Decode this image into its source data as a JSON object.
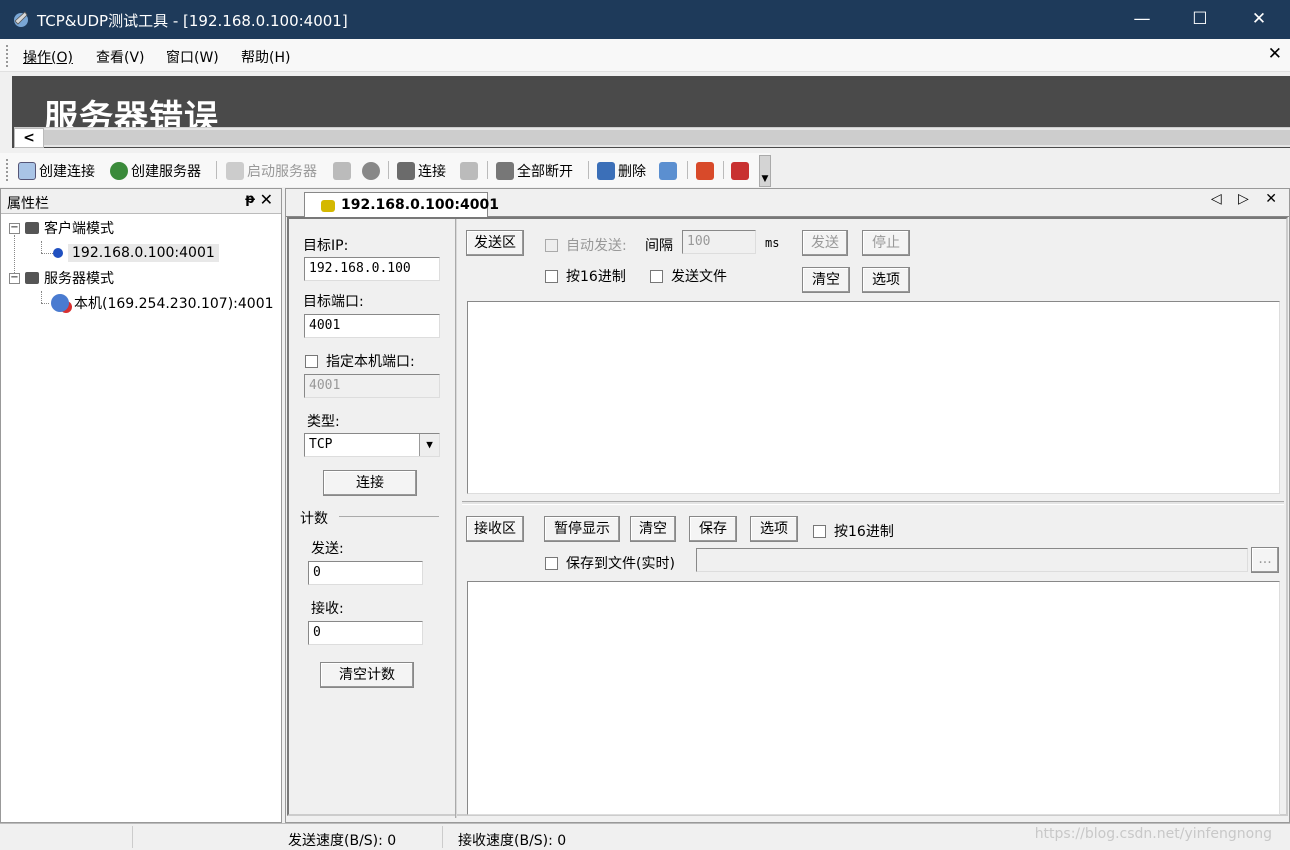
{
  "window": {
    "title": "TCP&UDP测试工具 - [192.168.0.100:4001]",
    "minimize": "—",
    "maximize": "☐",
    "close": "✕"
  },
  "menu": {
    "items": [
      "操作(O)",
      "查看(V)",
      "窗口(W)",
      "帮助(H)"
    ],
    "close": "✕"
  },
  "error_pane": {
    "title": "服务器错误",
    "scroll_left": "<"
  },
  "toolbar": {
    "create_connection": "创建连接",
    "create_server": "创建服务器",
    "start_server": "启动服务器",
    "connect": "连接",
    "disconnect_all": "全部断开",
    "delete": "删除"
  },
  "sidebar": {
    "title": "属性栏",
    "pin": "ᵽ",
    "close": "✕",
    "tree": {
      "client_mode": "客户端模式",
      "client_connection": "192.168.0.100:4001",
      "server_mode": "服务器模式",
      "server_local": "本机(169.254.230.107):4001"
    }
  },
  "tab": {
    "label": "192.168.0.100:4001",
    "nav": "◁ ▷ ✕"
  },
  "connection_form": {
    "target_ip_label": "目标IP:",
    "target_ip_value": "192.168.0.100",
    "target_port_label": "目标端口:",
    "target_port_value": "4001",
    "local_port_checkbox": "指定本机端口:",
    "local_port_value": "4001",
    "type_label": "类型:",
    "type_value": "TCP",
    "connect_button": "连接",
    "count_label": "计数",
    "send_count_label": "发送:",
    "send_count_value": "0",
    "recv_count_label": "接收:",
    "recv_count_value": "0",
    "clear_count_button": "清空计数"
  },
  "send_area": {
    "label": "发送区",
    "auto_send": "自动发送:",
    "interval_label": "间隔",
    "interval_value": "100",
    "interval_unit": "ms",
    "send_button": "发送",
    "stop_button": "停止",
    "hex_checkbox": "按16进制",
    "send_file_checkbox": "发送文件",
    "clear_button": "清空",
    "options_button": "选项"
  },
  "recv_area": {
    "label": "接收区",
    "pause_button": "暂停显示",
    "clear_button": "清空",
    "save_button": "保存",
    "options_button": "选项",
    "hex_checkbox": "按16进制",
    "save_file_checkbox": "保存到文件(实时)",
    "browse_button": "..."
  },
  "status": {
    "send_speed": "发送速度(B/S): 0",
    "recv_speed": "接收速度(B/S): 0",
    "watermark": "https://blog.csdn.net/yinfengnong"
  }
}
